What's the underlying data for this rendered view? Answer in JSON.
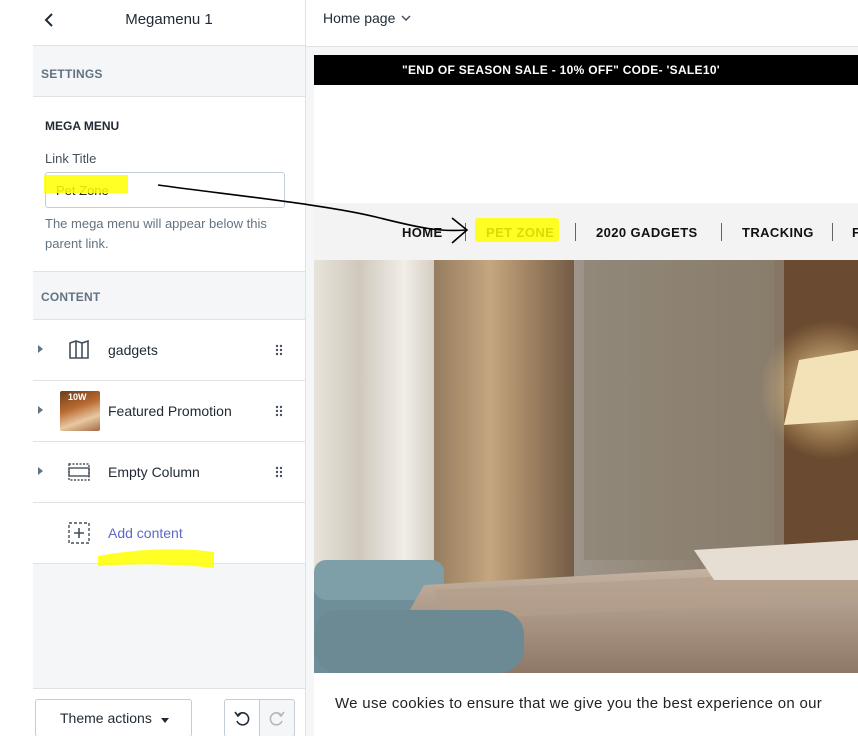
{
  "sidebar": {
    "title": "Megamenu 1",
    "settings_heading": "SETTINGS",
    "mega_menu_heading": "MEGA MENU",
    "link_title_label": "Link Title",
    "link_title_value": "Pet Zone",
    "help_text": "The mega menu will appear below this parent link.",
    "content_heading": "CONTENT",
    "items": [
      {
        "label": "gadgets",
        "icon": "layout-icon"
      },
      {
        "label": "Featured Promotion",
        "icon": "image-thumbnail",
        "thumb_text": "10W"
      },
      {
        "label": "Empty Column",
        "icon": "column-icon"
      }
    ],
    "add_content": "Add content",
    "footer": {
      "theme_actions": "Theme actions"
    }
  },
  "topbar": {
    "page": "Home page"
  },
  "preview": {
    "announcement": "\"END OF SEASON SALE - 10% OFF\" CODE- 'SALE10'",
    "nav": [
      "HOME",
      "PET ZONE",
      "2020 GADGETS",
      "TRACKING"
    ],
    "cookie_text": "We use cookies to ensure that we give you the best experience on our"
  },
  "colors": {
    "highlight": "#ffff00",
    "accent": "#5c6ac4",
    "announcement_bg": "#000000"
  }
}
